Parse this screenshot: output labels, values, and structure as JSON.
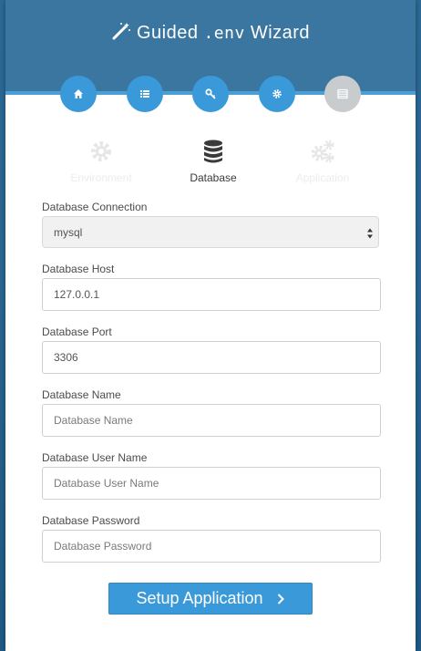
{
  "header": {
    "title_left": "Guided",
    "title_mono": ".env",
    "title_right": "Wizard",
    "wand_icon": "magic-wand-icon"
  },
  "steps": [
    {
      "icon": "home-icon",
      "active": true
    },
    {
      "icon": "list-icon",
      "active": true
    },
    {
      "icon": "key-icon",
      "active": true
    },
    {
      "icon": "gear-icon",
      "active": true
    },
    {
      "icon": "table-icon",
      "active": false
    }
  ],
  "tabs": {
    "environment": {
      "label": "Environment",
      "icon": "gear-icon"
    },
    "database": {
      "label": "Database",
      "icon": "database-icon"
    },
    "application": {
      "label": "Application",
      "icon": "gears-icon"
    }
  },
  "form": {
    "connection": {
      "label": "Database Connection",
      "value": "mysql"
    },
    "host": {
      "label": "Database Host",
      "value": "127.0.0.1"
    },
    "port": {
      "label": "Database Port",
      "value": "3306"
    },
    "name": {
      "label": "Database Name",
      "placeholder": "Database Name"
    },
    "username": {
      "label": "Database User Name",
      "placeholder": "Database User Name"
    },
    "password": {
      "label": "Database Password",
      "placeholder": "Database Password"
    }
  },
  "submit": {
    "label": "Setup Application"
  },
  "colors": {
    "header": "#3a76a0",
    "accent": "#3a9ad9",
    "inactive_step": "#c8cccf"
  }
}
